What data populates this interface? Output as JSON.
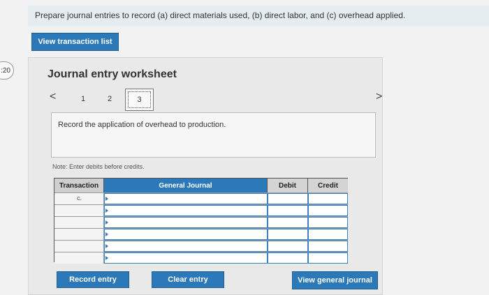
{
  "instruction": "Prepare journal entries to record (a) direct materials used, (b) direct labor, and (c) overhead applied.",
  "buttons": {
    "view_transaction_list": "View transaction list",
    "record_entry": "Record entry",
    "clear_entry": "Clear entry",
    "view_general_journal": "View general journal"
  },
  "timer": ":20",
  "worksheet": {
    "title": "Journal entry worksheet",
    "nav_prev": "<",
    "nav_next": ">",
    "pages": [
      "1",
      "2",
      "3"
    ],
    "current_page": "3",
    "prompt": "Record the application of overhead to production.",
    "note": "Note: Enter debits before credits."
  },
  "journal": {
    "headers": {
      "transaction": "Transaction",
      "general_journal": "General Journal",
      "debit": "Debit",
      "credit": "Credit"
    },
    "rows": [
      {
        "transaction": "c."
      },
      {
        "transaction": ""
      },
      {
        "transaction": ""
      },
      {
        "transaction": ""
      },
      {
        "transaction": ""
      },
      {
        "transaction": ""
      }
    ]
  },
  "colors": {
    "accent": "#2b79b8",
    "background": "#f2f2f2",
    "panel": "#e9e9e9"
  }
}
